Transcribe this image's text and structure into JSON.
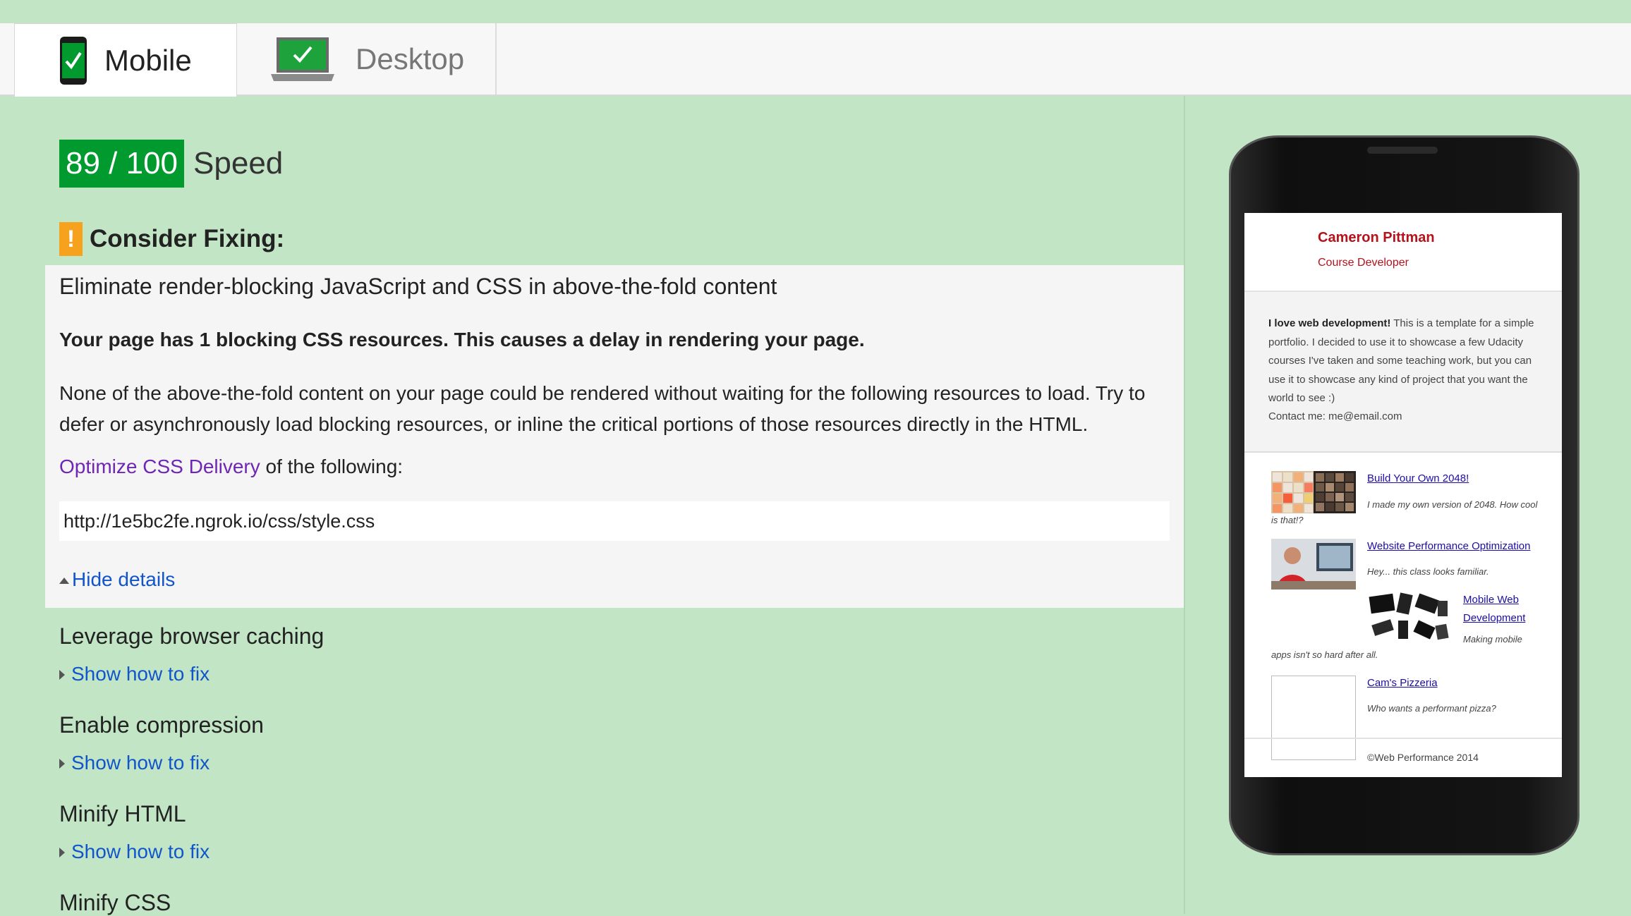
{
  "tabs": [
    {
      "label": "Mobile",
      "icon": "phone-check-icon",
      "active": true
    },
    {
      "label": "Desktop",
      "icon": "laptop-check-icon",
      "active": false
    }
  ],
  "score": {
    "value": "89 / 100",
    "label": "Speed",
    "color": "#009a2e"
  },
  "consider": {
    "title": "Consider Fixing:",
    "icon": "warning-icon",
    "color": "#f6a21d"
  },
  "expanded_rule": {
    "title": "Eliminate render-blocking JavaScript and CSS in above-the-fold content",
    "bold_text": "Your page has 1 blocking CSS resources. This causes a delay in rendering your page.",
    "description": "None of the above-the-fold content on your page could be rendered without waiting for the following resources to load. Try to defer or asynchronously load blocking resources, or inline the critical portions of those resources directly in the HTML.",
    "link_text": "Optimize CSS Delivery",
    "link_suffix": " of the following:",
    "url": "http://1e5bc2fe.ngrok.io/css/style.css",
    "hide_label": "Hide details"
  },
  "rules": [
    {
      "title": "Leverage browser caching",
      "fix_label": "Show how to fix"
    },
    {
      "title": "Enable compression",
      "fix_label": "Show how to fix"
    },
    {
      "title": "Minify HTML",
      "fix_label": "Show how to fix"
    },
    {
      "title": "Minify CSS"
    }
  ],
  "preview": {
    "name": "Cameron Pittman",
    "role": "Course Developer",
    "about_bold": "I love web development!",
    "about_text": " This is a template for a simple portfolio. I decided to use it to showcase a few Udacity courses I've taken and some teaching work, but you can use it to showcase any kind of project that you want the world to see :)",
    "contact": "Contact me: me@email.com",
    "projects": [
      {
        "title": "Build Your Own 2048!",
        "caption": "I made my own version of 2048. How cool is that!?"
      },
      {
        "title": "Website Performance Optimization",
        "caption": "Hey... this class looks familiar."
      },
      {
        "title": "Mobile Web Development",
        "caption": "Making mobile apps isn't so hard after all."
      },
      {
        "title": "Cam's Pizzeria",
        "caption": "Who wants a performant pizza?"
      }
    ],
    "footer": "©Web Performance 2014"
  }
}
